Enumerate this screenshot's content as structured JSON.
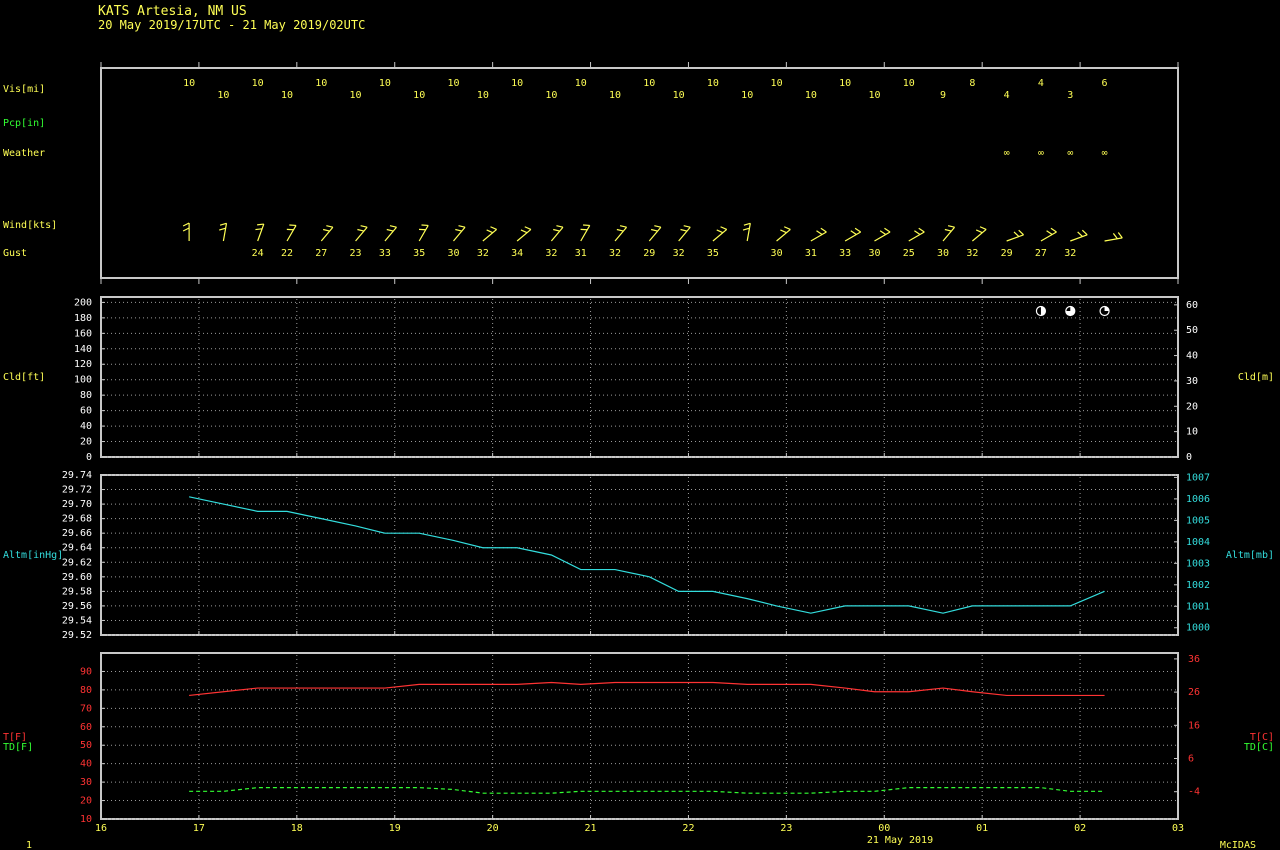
{
  "header": {
    "station": "KATS  Artesia, NM US",
    "period": "20 May 2019/17UTC - 21 May 2019/02UTC"
  },
  "colors": {
    "frame": "#c8c8c8",
    "yellow": "#ffff55",
    "green": "#33ff33",
    "cyan": "#33dddd",
    "red": "#ff3333",
    "white": "#ffffff",
    "grid": "#9a9a9a"
  },
  "labels": {
    "vis": "Vis[mi]",
    "pcp": "Pcp[in]",
    "weather": "Weather",
    "wind": "Wind[kts]",
    "gust": "Gust",
    "cld_left": "Cld[ft]",
    "cld_right": "Cld[m]",
    "altm_left": "Altm[inHg]",
    "altm_right": "Altm[mb]",
    "t_left": "T[F]",
    "td_left": "TD[F]",
    "t_right": "T[C]",
    "td_right": "TD[C]",
    "date": "21 May 2019",
    "corner": "1",
    "brand": "McIDAS"
  },
  "chart_data": {
    "type": "line",
    "x_ticks": [
      "16",
      "17",
      "18",
      "19",
      "20",
      "21",
      "22",
      "23",
      "00",
      "01",
      "02",
      "03"
    ],
    "obs_times": [
      16.9,
      17.25,
      17.6,
      17.9,
      18.25,
      18.6,
      18.9,
      19.25,
      19.6,
      19.9,
      20.25,
      20.6,
      20.9,
      21.25,
      21.6,
      21.9,
      22.25,
      22.6,
      22.9,
      23.25,
      23.6,
      23.9,
      24.25,
      24.6,
      24.9,
      25.25,
      25.6,
      25.9,
      26.25
    ],
    "vis": {
      "values": [
        "10",
        "10",
        "10",
        "10",
        "10",
        "10",
        "10",
        "10",
        "10",
        "10",
        "10",
        "10",
        "10",
        "10",
        "10",
        "10",
        "10",
        "10",
        "10",
        "10",
        "10",
        "10",
        "10",
        "9",
        "8",
        "4",
        "4",
        "3",
        "6"
      ]
    },
    "weather": {
      "symbol": "∞",
      "times": [
        25.25,
        25.6,
        25.9,
        26.25
      ]
    },
    "wind": {
      "dir_deg": [
        180,
        190,
        200,
        210,
        220,
        220,
        220,
        210,
        220,
        230,
        230,
        220,
        210,
        220,
        220,
        220,
        230,
        190,
        230,
        240,
        240,
        240,
        240,
        220,
        230,
        250,
        240,
        250,
        260,
        260
      ],
      "gust": [
        "",
        "",
        "24",
        "22",
        "27",
        "23",
        "33",
        "35",
        "30",
        "32",
        "34",
        "32",
        "31",
        "32",
        "29",
        "32",
        "35",
        "",
        "30",
        "31",
        "33",
        "30",
        "25",
        "30",
        "32",
        "29",
        "27",
        "32",
        ""
      ]
    },
    "cloud": {
      "yticks_ft": [
        0,
        20,
        40,
        60,
        80,
        100,
        120,
        140,
        160,
        180,
        200
      ],
      "yticks_m": [
        0,
        10,
        20,
        30,
        40,
        50,
        60
      ],
      "ylim_ft": [
        0,
        200
      ],
      "cover_times": [
        25.6,
        25.9,
        26.25
      ],
      "cover_fraction": [
        0.5,
        0.75,
        0.25
      ]
    },
    "altimeter": {
      "yticks_inHg": [
        "29.52",
        "29.54",
        "29.56",
        "29.58",
        "29.60",
        "29.62",
        "29.64",
        "29.66",
        "29.68",
        "29.70",
        "29.72",
        "29.74"
      ],
      "yticks_mb": [
        "1000",
        "1001",
        "1002",
        "1003",
        "1004",
        "1005",
        "1006",
        "1007"
      ],
      "ylim": [
        29.52,
        29.74
      ],
      "values": [
        29.71,
        29.7,
        29.69,
        29.69,
        29.68,
        29.67,
        29.66,
        29.66,
        29.65,
        29.64,
        29.64,
        29.63,
        29.61,
        29.61,
        29.6,
        29.58,
        29.58,
        29.57,
        29.56,
        29.55,
        29.56,
        29.56,
        29.56,
        29.55,
        29.56,
        29.56,
        29.56,
        29.56,
        29.58
      ]
    },
    "temperature": {
      "yticks_F": [
        10,
        20,
        30,
        40,
        50,
        60,
        70,
        80,
        90
      ],
      "yticks_C": [
        -4,
        6,
        16,
        26,
        36
      ],
      "ylim_F": [
        10,
        100
      ],
      "series": [
        {
          "name": "T[F]",
          "values": [
            77,
            79,
            81,
            81,
            81,
            81,
            81,
            83,
            83,
            83,
            83,
            84,
            83,
            84,
            84,
            84,
            84,
            83,
            83,
            83,
            81,
            79,
            79,
            81,
            79,
            77,
            77,
            77,
            77
          ]
        },
        {
          "name": "TD[F]",
          "values": [
            25,
            25,
            27,
            27,
            27,
            27,
            27,
            27,
            26,
            24,
            24,
            24,
            25,
            25,
            25,
            25,
            25,
            24,
            24,
            24,
            25,
            25,
            27,
            27,
            27,
            27,
            27,
            25,
            25
          ]
        }
      ]
    }
  }
}
